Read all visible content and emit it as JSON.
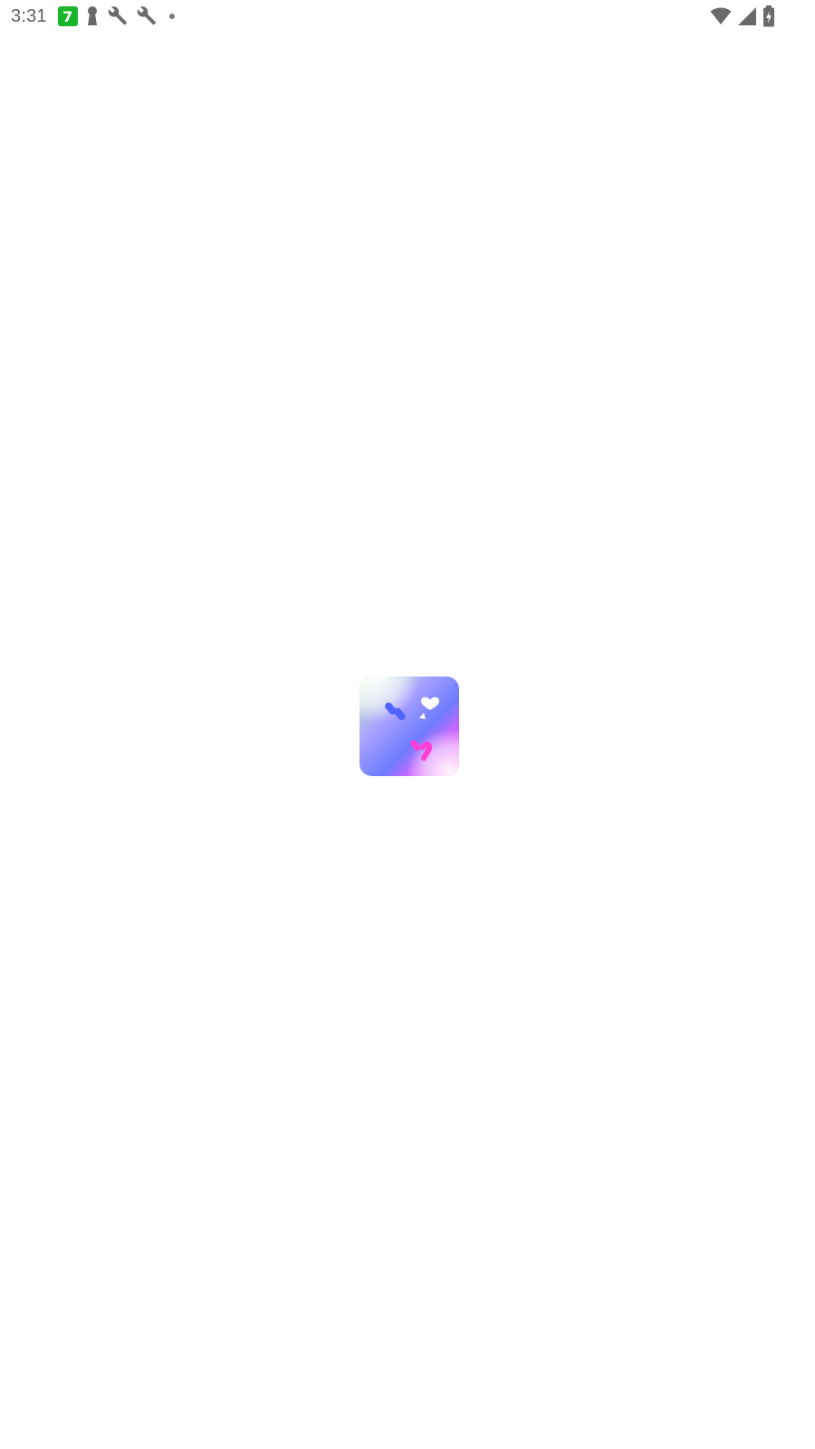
{
  "status_bar": {
    "time": "3:31",
    "notification_icons": [
      "app-7-icon",
      "keyhole-icon",
      "wrench-icon",
      "wrench-icon",
      "dot-icon"
    ],
    "system_icons": [
      "wifi-icon",
      "cellular-signal-icon",
      "battery-charging-icon"
    ],
    "app_badge_text": "7",
    "colors": {
      "status_text": "#5f5f5f",
      "app_badge": "#19b52b"
    }
  },
  "splash": {
    "logo_icon": "app-logo-icon",
    "colors": {
      "background": "#ffffff",
      "logo_blue": "#5b6cff",
      "logo_pink": "#ff5ce6",
      "logo_green": "#a6f0b6"
    }
  }
}
